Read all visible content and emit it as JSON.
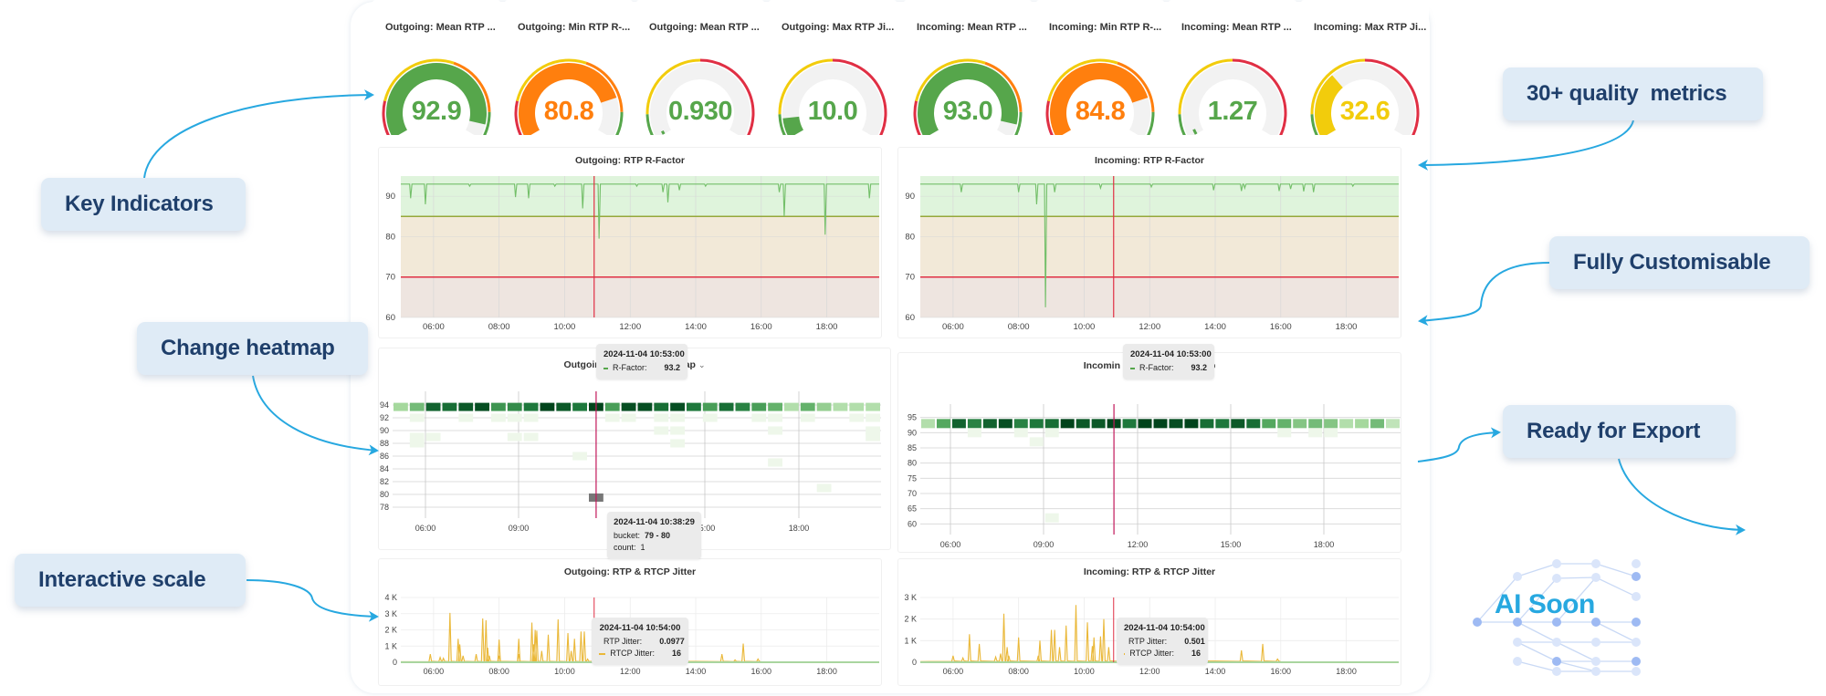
{
  "stats": [
    {
      "title": "Outgoing: Mean RTP ...",
      "value": "92.9",
      "fraction": 0.93,
      "color": "#56a64b",
      "scheme": "rfactor"
    },
    {
      "title": "Outgoing: Min RTP R-...",
      "value": "80.8",
      "fraction": 0.8,
      "color": "#ff7f0e",
      "scheme": "rfactor"
    },
    {
      "title": "Outgoing: Mean RTP ...",
      "value": "0.930",
      "fraction": 0.02,
      "color": "#56a64b",
      "scheme": "jitter"
    },
    {
      "title": "Outgoing: Max RTP Ji...",
      "value": "10.0",
      "fraction": 0.1,
      "color": "#56a64b",
      "scheme": "jitter"
    },
    {
      "title": "Incoming: Mean RTP ...",
      "value": "93.0",
      "fraction": 0.93,
      "color": "#56a64b",
      "scheme": "rfactor"
    },
    {
      "title": "Incoming: Min RTP R-...",
      "value": "84.8",
      "fraction": 0.8,
      "color": "#ff7f0e",
      "scheme": "rfactor"
    },
    {
      "title": "Incoming: Mean RTP ...",
      "value": "1.27",
      "fraction": 0.03,
      "color": "#56a64b",
      "scheme": "jitter"
    },
    {
      "title": "Incoming: Max RTP Ji...",
      "value": "32.6",
      "fraction": 0.33,
      "color": "#f2cc0c",
      "scheme": "jitter"
    }
  ],
  "colors": {
    "green": "#56a64b",
    "orange": "#ff7f0e",
    "yellow": "#f2cc0c",
    "red": "#e02f44",
    "callout_bg": "#dfebf6",
    "callout_text": "#1f3f6b",
    "arrow": "#27a8e0"
  },
  "chart_data": [
    {
      "id": "out-rfactor",
      "type": "line",
      "title": "Outgoing: RTP R-Factor",
      "x_ticks": [
        "06:00",
        "08:00",
        "10:00",
        "12:00",
        "14:00",
        "16:00",
        "18:00"
      ],
      "x_range_hours": [
        5.0,
        19.6
      ],
      "y_ticks": [
        "60",
        "70",
        "80",
        "90"
      ],
      "ylim": [
        60,
        95
      ],
      "thresholds": [
        {
          "value": 85,
          "color": "#96a83a"
        },
        {
          "value": 70,
          "color": "#e02f44"
        }
      ],
      "baseline": 93,
      "dips": [
        [
          5.3,
          89.5
        ],
        [
          5.75,
          88
        ],
        [
          7.1,
          92.5
        ],
        [
          8.5,
          89.8
        ],
        [
          8.9,
          89.5
        ],
        [
          9.7,
          92.5
        ],
        [
          10.55,
          87
        ],
        [
          11.05,
          79.5
        ],
        [
          12.2,
          92.5
        ],
        [
          13.0,
          91
        ],
        [
          13.15,
          88.5
        ],
        [
          13.5,
          91.5
        ],
        [
          14.3,
          92.5
        ],
        [
          16.55,
          91
        ],
        [
          16.7,
          85
        ],
        [
          17.95,
          80.5
        ],
        [
          19.3,
          89.5
        ]
      ],
      "cursor_hour": 10.9
    },
    {
      "id": "in-rfactor",
      "type": "line",
      "title": "Incoming: RTP R-Factor",
      "x_ticks": [
        "06:00",
        "08:00",
        "10:00",
        "12:00",
        "14:00",
        "16:00",
        "18:00"
      ],
      "x_range_hours": [
        5.0,
        19.6
      ],
      "y_ticks": [
        "60",
        "70",
        "80",
        "90"
      ],
      "ylim": [
        60,
        95
      ],
      "thresholds": [
        {
          "value": 85,
          "color": "#96a83a"
        },
        {
          "value": 70,
          "color": "#e02f44"
        }
      ],
      "baseline": 93,
      "dips": [
        [
          6.25,
          91
        ],
        [
          8.0,
          91
        ],
        [
          8.55,
          88
        ],
        [
          8.82,
          62.5
        ],
        [
          9.1,
          91
        ],
        [
          10.5,
          92
        ],
        [
          12.05,
          92.3
        ],
        [
          13.95,
          91.5
        ],
        [
          14.8,
          91.3
        ],
        [
          14.9,
          92
        ],
        [
          15.95,
          91.3
        ],
        [
          16.3,
          91.8
        ],
        [
          16.7,
          91.2
        ],
        [
          17.0,
          91
        ],
        [
          18.2,
          92.5
        ]
      ],
      "cursor_hour": 10.9
    },
    {
      "id": "out-heatmap",
      "type": "heatmap",
      "title": "Outgoing: R-Factor Heatmap",
      "x_ticks": [
        "06:00",
        "09:00",
        "15:00",
        "18:00"
      ],
      "y_ticks": [
        "78",
        "80",
        "82",
        "84",
        "86",
        "88",
        "90",
        "92",
        "94"
      ],
      "ylim": [
        77,
        95
      ],
      "top_row_intensity": [
        0.25,
        0.4,
        0.85,
        0.8,
        0.9,
        0.95,
        0.6,
        0.65,
        0.75,
        1.0,
        0.9,
        0.75,
        1.0,
        0.55,
        0.95,
        0.95,
        0.8,
        0.95,
        0.75,
        0.55,
        0.8,
        0.7,
        0.55,
        0.45,
        0.2,
        0.45,
        0.3,
        0.2,
        0.2,
        0.2
      ],
      "sparse_cells": [
        [
          1,
          92
        ],
        [
          4,
          92
        ],
        [
          6,
          92
        ],
        [
          7,
          92
        ],
        [
          8,
          92
        ],
        [
          13,
          92
        ],
        [
          14,
          92
        ],
        [
          16,
          92
        ],
        [
          17,
          92
        ],
        [
          19,
          92
        ],
        [
          22,
          92
        ],
        [
          23,
          92
        ],
        [
          25,
          92
        ],
        [
          28,
          92
        ],
        [
          29,
          92
        ],
        [
          16,
          90
        ],
        [
          17,
          90
        ],
        [
          23,
          90
        ],
        [
          29,
          90
        ],
        [
          1,
          89
        ],
        [
          2,
          89
        ],
        [
          7,
          89
        ],
        [
          8,
          89
        ],
        [
          29,
          89
        ],
        [
          1,
          88
        ],
        [
          17,
          88
        ],
        [
          11,
          86
        ],
        [
          23,
          85
        ],
        [
          26,
          81
        ]
      ],
      "highlight_cell": {
        "col": 12,
        "bucket": 79.5
      },
      "cursor_col": 12
    },
    {
      "id": "in-heatmap",
      "type": "heatmap",
      "title": "Incoming: R-Factor Heatmap",
      "x_ticks": [
        "06:00",
        "09:00",
        "12:00",
        "15:00",
        "18:00"
      ],
      "y_ticks": [
        "60",
        "65",
        "70",
        "75",
        "80",
        "85",
        "90",
        "95"
      ],
      "ylim": [
        58,
        97
      ],
      "top_row_intensity": [
        0.2,
        0.5,
        0.85,
        0.7,
        0.85,
        0.95,
        0.7,
        0.75,
        0.8,
        1.0,
        0.9,
        0.9,
        1.0,
        0.75,
        1.0,
        1.0,
        0.95,
        1.0,
        0.8,
        0.75,
        0.9,
        0.8,
        0.5,
        0.45,
        0.35,
        0.4,
        0.35,
        0.2,
        0.25,
        0.4,
        0.15
      ],
      "sparse_cells": [
        [
          3,
          90
        ],
        [
          6,
          90
        ],
        [
          8,
          90
        ],
        [
          23,
          90
        ],
        [
          25,
          90
        ],
        [
          26,
          90
        ],
        [
          7,
          87
        ],
        [
          8,
          62
        ]
      ],
      "cursor_col": 12
    },
    {
      "id": "out-jitter",
      "type": "line",
      "title": "Outgoing: RTP & RTCP Jitter",
      "x_ticks": [
        "06:00",
        "08:00",
        "10:00",
        "12:00",
        "14:00",
        "16:00",
        "18:00"
      ],
      "x_range_hours": [
        5.0,
        19.6
      ],
      "y_ticks": [
        "0",
        "1 K",
        "2 K",
        "3 K",
        "4 K"
      ],
      "ylim": [
        0,
        4000
      ],
      "series": [
        {
          "name": "RTCP Jitter",
          "color": "#eab839",
          "spikes": [
            [
              5.9,
              500
            ],
            [
              6.2,
              300
            ],
            [
              6.3,
              250
            ],
            [
              6.5,
              3050
            ],
            [
              6.75,
              1450
            ],
            [
              6.8,
              1100
            ],
            [
              6.9,
              400
            ],
            [
              7.3,
              500
            ],
            [
              7.5,
              2700
            ],
            [
              7.6,
              2600
            ],
            [
              7.65,
              900
            ],
            [
              7.7,
              400
            ],
            [
              8.0,
              1400
            ],
            [
              8.0,
              400
            ],
            [
              8.6,
              500
            ],
            [
              8.6,
              1450
            ],
            [
              9.0,
              2450
            ],
            [
              9.05,
              1100
            ],
            [
              9.1,
              2000
            ],
            [
              9.15,
              1950
            ],
            [
              9.3,
              700
            ],
            [
              9.5,
              1700
            ],
            [
              9.8,
              2650
            ],
            [
              10.1,
              1800
            ],
            [
              10.2,
              700
            ],
            [
              10.3,
              1450
            ],
            [
              10.5,
              1900
            ],
            [
              10.6,
              1900
            ],
            [
              10.7,
              200
            ],
            [
              11.1,
              2300
            ],
            [
              11.2,
              900
            ],
            [
              11.5,
              500
            ],
            [
              12.3,
              300
            ],
            [
              13.0,
              800
            ],
            [
              13.6,
              300
            ],
            [
              14.8,
              500
            ],
            [
              15.2,
              150
            ],
            [
              15.45,
              1150
            ],
            [
              15.9,
              200
            ]
          ]
        },
        {
          "name": "RTP Jitter",
          "color": "#56a64b",
          "flat": 0
        }
      ],
      "cursor_hour": 10.9
    },
    {
      "id": "in-jitter",
      "type": "line",
      "title": "Incoming: RTP & RTCP Jitter",
      "x_ticks": [
        "06:00",
        "08:00",
        "10:00",
        "12:00",
        "14:00",
        "16:00",
        "18:00"
      ],
      "x_range_hours": [
        5.0,
        19.6
      ],
      "y_ticks": [
        "0",
        "1 K",
        "2 K",
        "3 K"
      ],
      "ylim": [
        0,
        3000
      ],
      "series": [
        {
          "name": "RTCP Jitter",
          "color": "#eab839",
          "spikes": [
            [
              6.0,
              300
            ],
            [
              6.3,
              200
            ],
            [
              6.5,
              1300
            ],
            [
              6.8,
              850
            ],
            [
              7.3,
              250
            ],
            [
              7.45,
              400
            ],
            [
              7.55,
              2250
            ],
            [
              7.65,
              700
            ],
            [
              7.7,
              300
            ],
            [
              8.0,
              1150
            ],
            [
              8.6,
              300
            ],
            [
              8.65,
              1000
            ],
            [
              9.0,
              1500
            ],
            [
              9.1,
              1500
            ],
            [
              9.25,
              700
            ],
            [
              9.45,
              1700
            ],
            [
              9.75,
              2650
            ],
            [
              10.1,
              1850
            ],
            [
              10.25,
              750
            ],
            [
              10.3,
              1150
            ],
            [
              10.5,
              1200
            ],
            [
              10.6,
              2000
            ],
            [
              10.75,
              700
            ],
            [
              11.1,
              1650
            ],
            [
              11.5,
              400
            ],
            [
              12.5,
              200
            ],
            [
              13.7,
              150
            ],
            [
              14.8,
              550
            ],
            [
              15.45,
              850
            ],
            [
              15.9,
              150
            ]
          ]
        },
        {
          "name": "RTP Jitter",
          "color": "#56a64b",
          "flat": 0
        }
      ],
      "cursor_hour": 10.9
    }
  ],
  "tooltips": {
    "heatmap_hover": {
      "time": "2024-11-04 10:53:00",
      "label": "R-Factor:",
      "value": "93.2"
    },
    "heatmap_bucket": {
      "time": "2024-11-04 10:38:29",
      "bucket_label": "bucket:",
      "bucket": "79 - 80",
      "count_label": "count:",
      "count": "1"
    },
    "out_jitter": {
      "time": "2024-11-04 10:54:00",
      "rows": [
        {
          "label": "RTP Jitter:",
          "value": "0.0977",
          "color": "#56a64b"
        },
        {
          "label": "RTCP Jitter:",
          "value": "16",
          "color": "#eab839"
        }
      ]
    },
    "in_jitter": {
      "time": "2024-11-04 10:54:00",
      "rows": [
        {
          "label": "RTP Jitter:",
          "value": "0.501",
          "color": "#56a64b"
        },
        {
          "label": "RTCP Jitter:",
          "value": "16",
          "color": "#eab839"
        }
      ]
    }
  },
  "heatmap_titles": {
    "out_left": "Outgoin",
    "out_right": "ap",
    "in_left": "Incomin",
    "in_right": "ap",
    "chevron": "⌄"
  },
  "callouts": {
    "key_indicators": "Key Indicators",
    "change_heatmap": "Change heatmap",
    "interactive_scale": "Interactive scale",
    "quality_metrics": "30+ quality  metrics",
    "fully_customisable": "Fully Customisable",
    "ready_for_export": "Ready for Export",
    "ai_soon": "AI Soon"
  }
}
